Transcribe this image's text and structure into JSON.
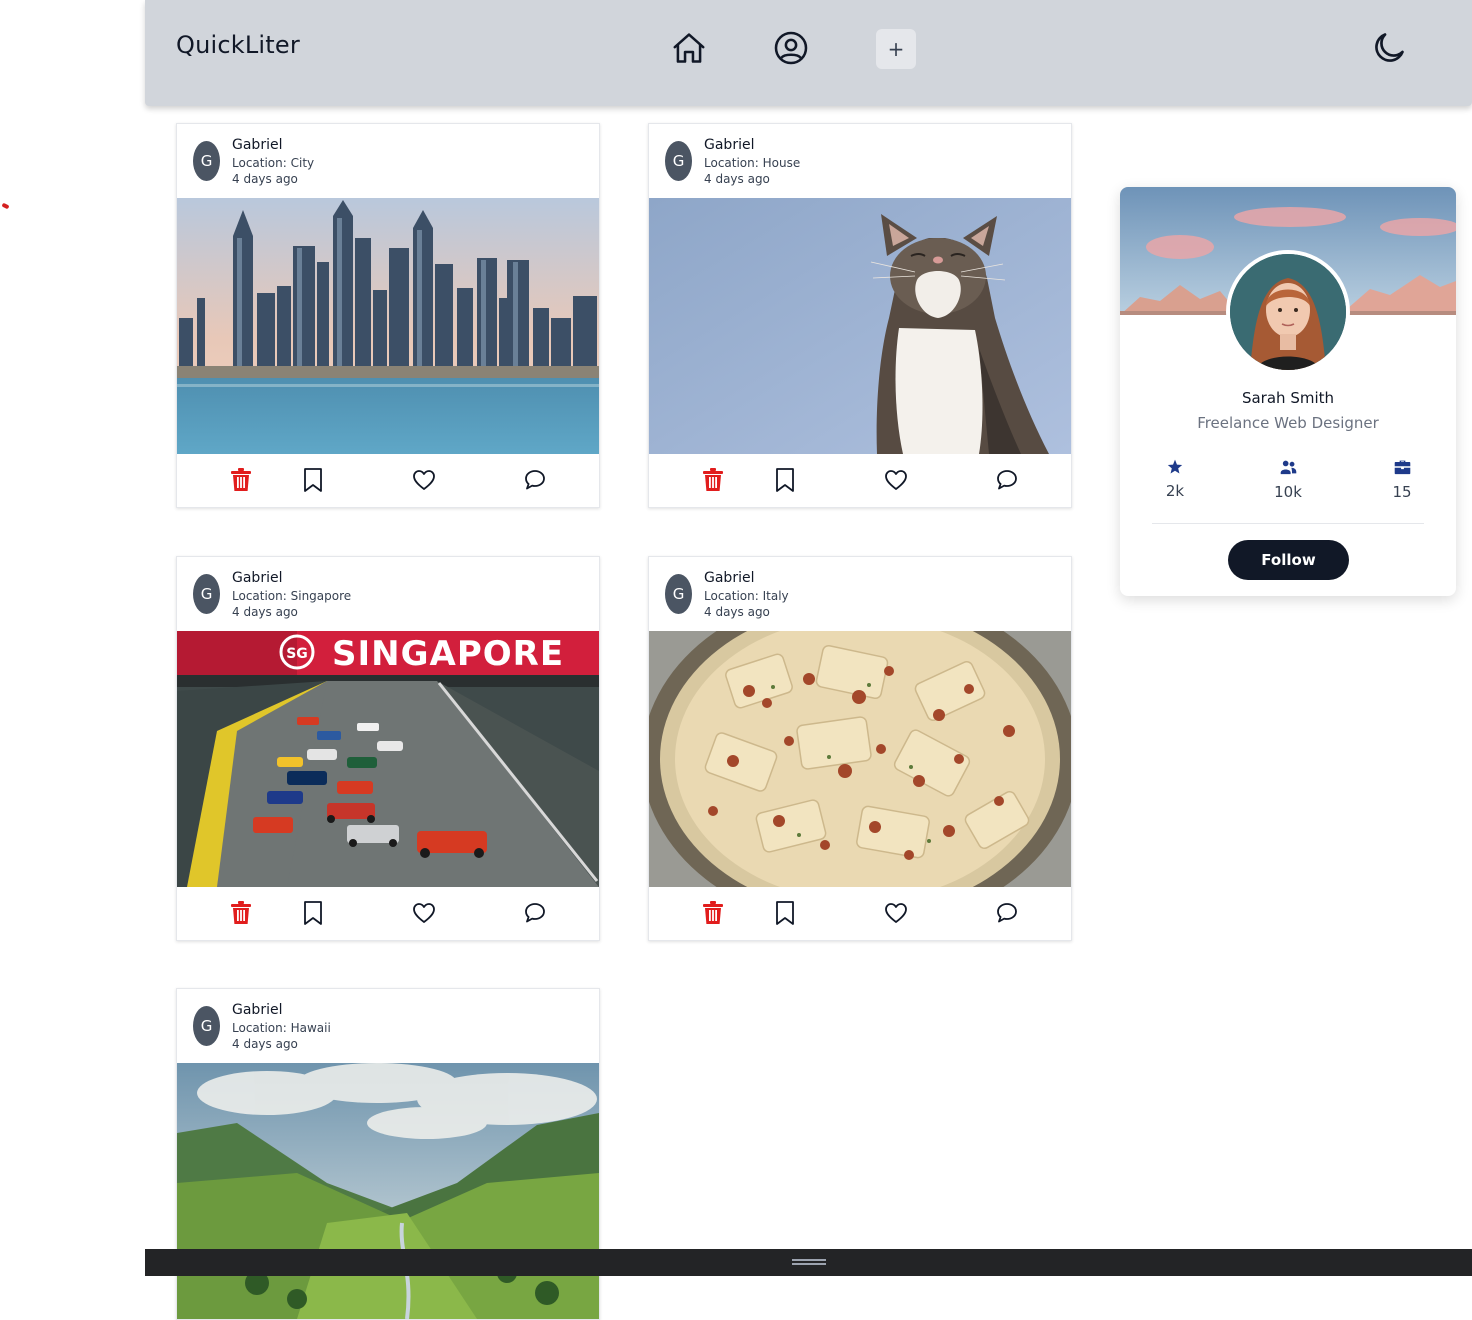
{
  "app": {
    "brand": "QuickLiter"
  },
  "navbar": {
    "icons": [
      "home-icon",
      "user-circle-icon",
      "plus-icon",
      "moon-icon"
    ],
    "add_label": "+"
  },
  "posts": [
    {
      "avatar": "G",
      "author": "Gabriel",
      "location": "Location: City",
      "time": "4 days ago",
      "image": "city skyline"
    },
    {
      "avatar": "G",
      "author": "Gabriel",
      "location": "Location: House",
      "time": "4 days ago",
      "image": "cat"
    },
    {
      "avatar": "G",
      "author": "Gabriel",
      "location": "Location: Singapore",
      "time": "4 days ago",
      "image": "singapore race"
    },
    {
      "avatar": "G",
      "author": "Gabriel",
      "location": "Location: Italy",
      "time": "4 days ago",
      "image": "pasta"
    },
    {
      "avatar": "G",
      "author": "Gabriel",
      "location": "Location: Hawaii",
      "time": "4 days ago",
      "image": "green valley"
    }
  ],
  "post_banner_text": "SINGAPORE",
  "post_banner_badge": "SG",
  "post_actions": [
    "trash-icon",
    "bookmark-icon",
    "heart-icon",
    "comment-icon"
  ],
  "profile": {
    "name": "Sarah Smith",
    "role": "Freelance Web Designer",
    "stats": [
      {
        "icon": "star-icon",
        "value": "2k"
      },
      {
        "icon": "users-icon",
        "value": "10k"
      },
      {
        "icon": "briefcase-icon",
        "value": "15"
      }
    ],
    "follow_label": "Follow"
  },
  "colors": {
    "navbar": "#d1d5db",
    "delete": "#e11d1d",
    "follow_button": "#111827",
    "stat_icon": "#1e3a8a"
  }
}
